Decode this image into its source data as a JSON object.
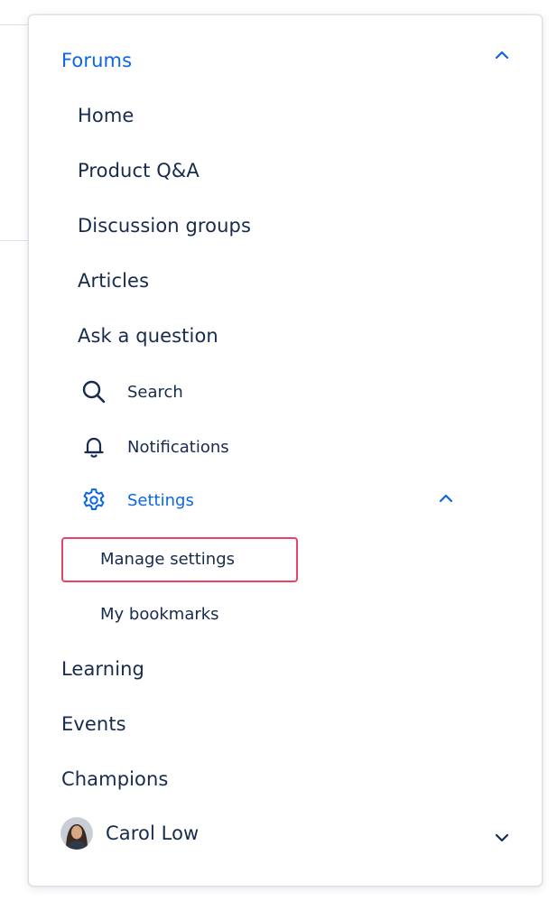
{
  "menu": {
    "forums": {
      "label": "Forums",
      "expanded": true,
      "chevron_icon": "chevron-up-icon",
      "items": [
        {
          "label": "Home"
        },
        {
          "label": "Product Q&A"
        },
        {
          "label": "Discussion groups"
        },
        {
          "label": "Articles"
        },
        {
          "label": "Ask a question"
        }
      ],
      "search": {
        "label": "Search",
        "icon": "search-icon"
      },
      "notifications": {
        "label": "Notifications",
        "icon": "bell-icon"
      },
      "settings": {
        "label": "Settings",
        "icon": "gear-icon",
        "expanded": true,
        "chevron_icon": "chevron-up-icon",
        "items": [
          {
            "label": "Manage settings",
            "highlighted": true
          },
          {
            "label": "My bookmarks"
          }
        ]
      }
    },
    "top_items": [
      {
        "label": "Learning"
      },
      {
        "label": "Events"
      },
      {
        "label": "Champions"
      }
    ],
    "user": {
      "name": "Carol Low",
      "chevron_icon": "chevron-down-icon"
    }
  },
  "colors": {
    "accent": "#0c66e4",
    "text": "#172b4d",
    "highlight": "#e8436b",
    "border": "#dcdfe4"
  }
}
